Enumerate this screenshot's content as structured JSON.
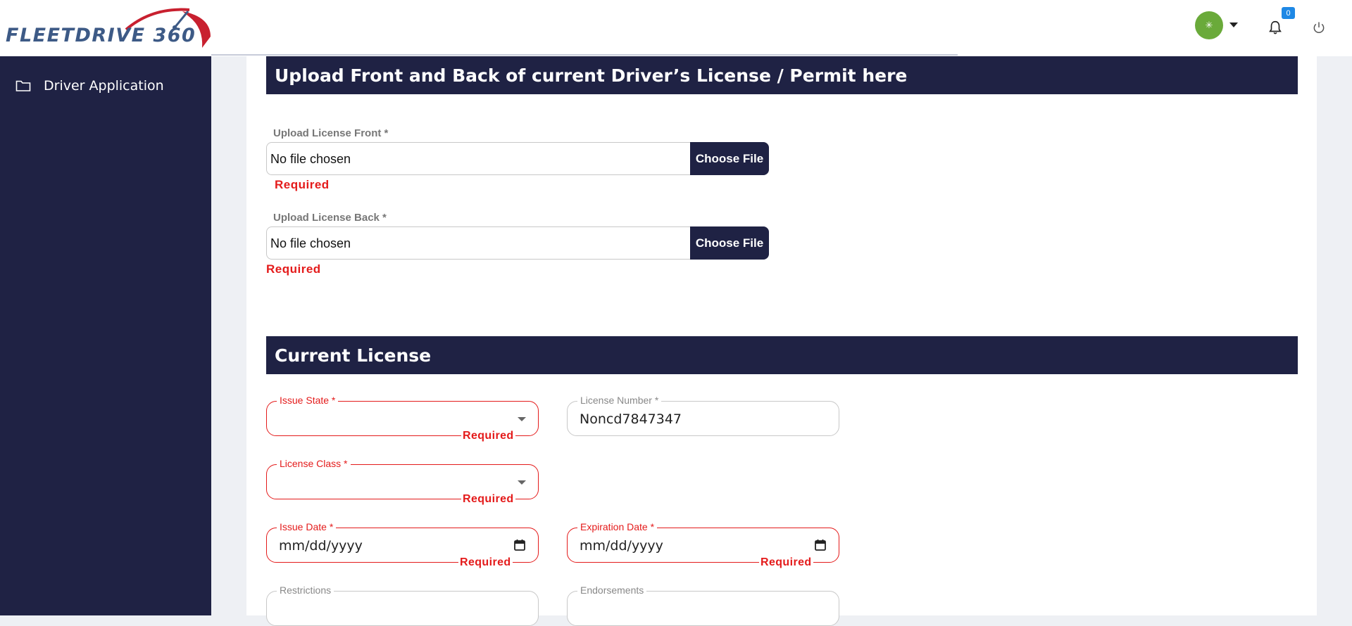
{
  "logo": {
    "text": "FLEETDRIVE 360",
    "colors": {
      "text": "#3d5a86",
      "accent": "#c8202f"
    }
  },
  "topbar": {
    "avatar_glyph": "✳",
    "notification_count": "0",
    "icons": [
      "bell-icon",
      "power-icon",
      "chevron-down-icon"
    ]
  },
  "sidebar": {
    "items": [
      {
        "label": "Driver Application",
        "icon": "folder-icon"
      }
    ]
  },
  "upload_section": {
    "title": "Upload Front and Back of current Driver’s License / Permit here",
    "front": {
      "label": "Upload License Front *",
      "value": "No file chosen",
      "button": "Choose File",
      "error": "Required"
    },
    "back": {
      "label": "Upload License Back *",
      "value": "No file chosen",
      "button": "Choose File",
      "error": "Required"
    }
  },
  "license_section": {
    "title": "Current License",
    "issue_state": {
      "label": "Issue State *",
      "value": "",
      "error": "Required"
    },
    "license_number": {
      "label": "License Number *",
      "value": "Noncd7847347"
    },
    "license_class": {
      "label": "License Class *",
      "value": "",
      "error": "Required"
    },
    "issue_date": {
      "label": "Issue Date *",
      "placeholder": "mm/dd/yyyy",
      "error": "Required"
    },
    "expiration_date": {
      "label": "Expiration Date *",
      "placeholder": "mm/dd/yyyy",
      "error": "Required"
    },
    "restrictions": {
      "label": "Restrictions",
      "value": ""
    },
    "endorsements": {
      "label": "Endorsements",
      "value": ""
    }
  },
  "colors": {
    "primary": "#1f2244",
    "error": "#e41b1b",
    "background": "#eef0f4",
    "avatar": "#6aaa3a",
    "badge": "#1e88e5"
  }
}
